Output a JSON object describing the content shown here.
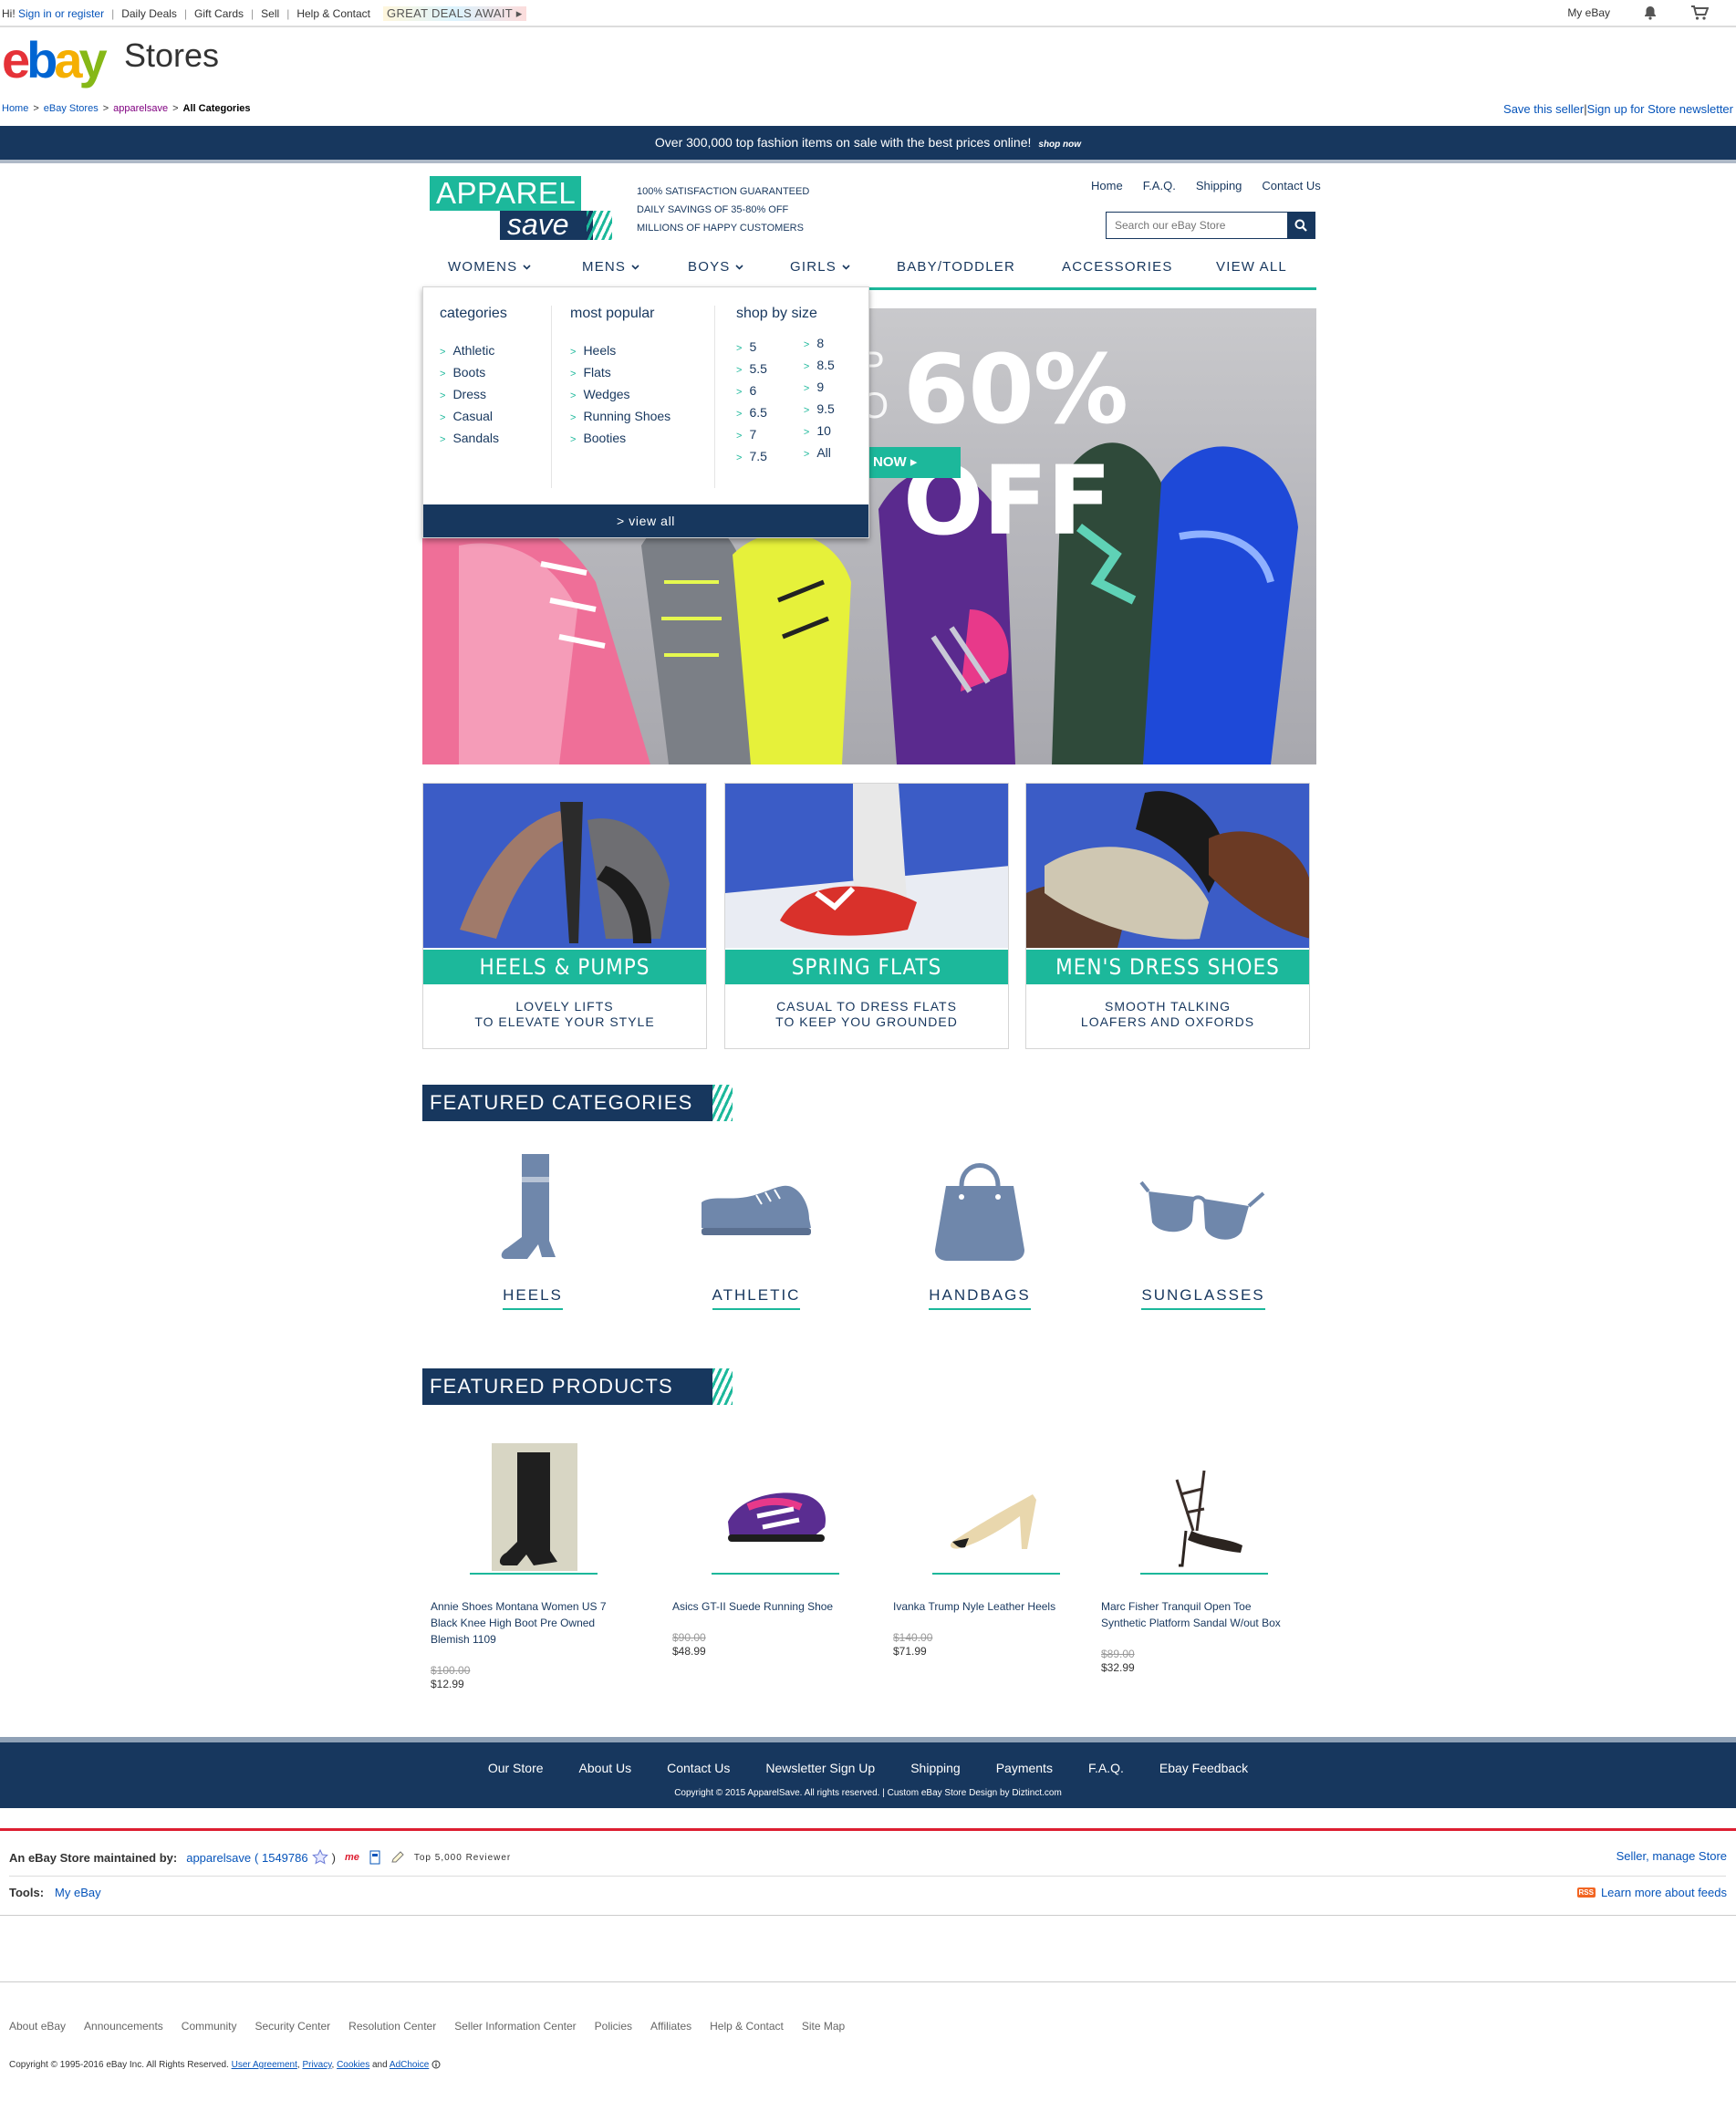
{
  "topbar": {
    "greeting": "Hi!",
    "sign_in": "Sign in",
    "or": "or",
    "register": "register",
    "links": [
      "Daily Deals",
      "Gift Cards",
      "Sell",
      "Help & Contact"
    ],
    "deals_banner": "GREAT DEALS AWAIT ▸",
    "my_ebay": "My eBay",
    "bell_icon": "bell-icon",
    "cart_icon": "cart-icon"
  },
  "header": {
    "logo": "ebay",
    "title": "Stores"
  },
  "breadcrumb": {
    "items": [
      "Home",
      "eBay Stores",
      "apparelsave",
      "All Categories"
    ],
    "separator": ">"
  },
  "seller_links": {
    "save_seller": "Save this seller",
    "divider": "|",
    "newsletter": "Sign up for Store newsletter"
  },
  "promo": {
    "text": "Over 300,000 top fashion items on sale with the best prices online!",
    "cta": "shop now"
  },
  "store": {
    "logo_top": "APPAREL",
    "logo_bottom": "save",
    "taglines": [
      "100% SATISFACTION GUARANTEED",
      "DAILY SAVINGS OF 35-80% OFF",
      "MILLIONS OF HAPPY CUSTOMERS"
    ],
    "nav": [
      "Home",
      "F.A.Q.",
      "Shipping",
      "Contact Us"
    ],
    "search_placeholder": "Search our eBay Store"
  },
  "mainnav": [
    "WOMENS",
    "MENS",
    "BOYS",
    "GIRLS",
    "BABY/TODDLER",
    "ACCESSORIES",
    "VIEW ALL"
  ],
  "mega": {
    "categories_title": "categories",
    "categories": [
      "Athletic",
      "Boots",
      "Dress",
      "Casual",
      "Sandals"
    ],
    "popular_title": "most popular",
    "popular": [
      "Heels",
      "Flats",
      "Wedges",
      "Running Shoes",
      "Booties"
    ],
    "size_title": "shop by size",
    "sizes_a": [
      "5",
      "5.5",
      "6",
      "6.5",
      "7",
      "7.5"
    ],
    "sizes_b": [
      "8",
      "8.5",
      "9",
      "9.5",
      "10",
      "All"
    ],
    "view_all": "> view all"
  },
  "hero": {
    "up": "P",
    "up2": "O",
    "headline": "60% OFF",
    "button": "NOW ▸"
  },
  "cards": [
    {
      "title": "HEELS & PUMPS",
      "line1": "LOVELY LIFTS",
      "line2": "TO ELEVATE YOUR STYLE"
    },
    {
      "title": "SPRING FLATS",
      "line1": "CASUAL TO DRESS FLATS",
      "line2": "TO KEEP YOU GROUNDED"
    },
    {
      "title": "MEN'S DRESS SHOES",
      "line1": "SMOOTH TALKING",
      "line2": "LOAFERS AND OXFORDS"
    }
  ],
  "featured_categories": {
    "title": "FEATURED CATEGORIES",
    "items": [
      {
        "label": "HEELS",
        "icon": "boot-icon"
      },
      {
        "label": "ATHLETIC",
        "icon": "sneaker-icon"
      },
      {
        "label": "HANDBAGS",
        "icon": "handbag-icon"
      },
      {
        "label": "SUNGLASSES",
        "icon": "sunglasses-icon"
      }
    ],
    "icon_color": "#6f87ab"
  },
  "featured_products": {
    "title": "FEATURED PRODUCTS",
    "items": [
      {
        "title": "Annie Shoes Montana Women US 7 Black Knee High Boot Pre Owned Blemish 1109",
        "old_price": "$100.00",
        "price": "$12.99"
      },
      {
        "title": "Asics GT-II Suede Running Shoe",
        "old_price": "$90.00",
        "price": "$48.99"
      },
      {
        "title": "Ivanka Trump Nyle Leather Heels",
        "old_price": "$140.00",
        "price": "$71.99"
      },
      {
        "title": "Marc Fisher Tranquil Open Toe Synthetic Platform Sandal W/out Box",
        "old_price": "$89.00",
        "price": "$32.99"
      }
    ]
  },
  "store_footer": {
    "links": [
      "Our Store",
      "About Us",
      "Contact Us",
      "Newsletter Sign Up",
      "Shipping",
      "Payments",
      "F.A.Q.",
      "Ebay Feedback"
    ],
    "copyright": "Copyright © 2015 ApparelSave. All rights reserved. | Custom eBay Store Design by Diztinct.com"
  },
  "infobox": {
    "maintained_label": "An eBay Store maintained by:",
    "seller": "apparelsave",
    "feedback": "( 1549786",
    "close_paren": ")",
    "me_badge": "me",
    "top_reviewer": "Top 5,000 Reviewer",
    "manage": "Seller, manage Store",
    "tools_label": "Tools:",
    "my_ebay": "My eBay",
    "rss": "RSS",
    "feeds": "Learn more about feeds"
  },
  "global_footer": {
    "links": [
      "About eBay",
      "Announcements",
      "Community",
      "Security Center",
      "Resolution Center",
      "Seller Information Center",
      "Policies",
      "Affiliates",
      "Help & Contact",
      "Site Map"
    ],
    "copyright": "Copyright © 1995-2016 eBay Inc. All Rights Reserved.",
    "legal": [
      "User Agreement",
      "Privacy",
      "Cookies",
      "AdChoice"
    ],
    "and": "and"
  },
  "colors": {
    "navy": "#17375e",
    "teal": "#1cb89b",
    "ebay_red": "#e53238",
    "ebay_blue": "#0064d2",
    "ebay_yellow": "#f5af02",
    "ebay_green": "#86b817"
  }
}
